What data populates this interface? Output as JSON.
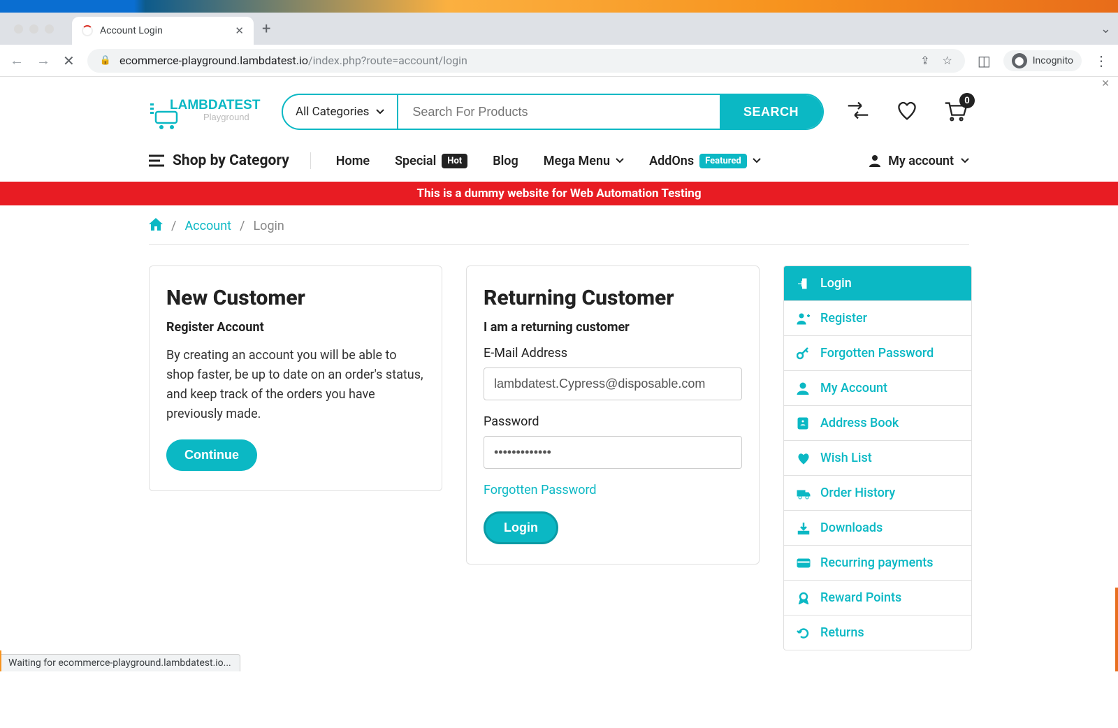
{
  "browser": {
    "tab_title": "Account Login",
    "url_host": "ecommerce-playground.lambdatest.io",
    "url_path": "/index.php?route=account/login",
    "incognito_label": "Incognito",
    "status": "Waiting for ecommerce-playground.lambdatest.io..."
  },
  "logo": {
    "top": "LAMBDATEST",
    "sub": "Playground"
  },
  "search": {
    "category": "All Categories",
    "placeholder": "Search For Products",
    "button": "SEARCH"
  },
  "header_icons": {
    "cart_count": "0"
  },
  "nav": {
    "shop_by": "Shop by Category",
    "items": [
      {
        "label": "Home"
      },
      {
        "label": "Special",
        "pill": "Hot",
        "pill_class": "hot"
      },
      {
        "label": "Blog"
      },
      {
        "label": "Mega Menu",
        "caret": true
      },
      {
        "label": "AddOns",
        "pill": "Featured",
        "pill_class": "feat",
        "caret": true
      }
    ],
    "my_account": "My account"
  },
  "banner": "This is a dummy website for Web Automation Testing",
  "breadcrumb": {
    "account": "Account",
    "login": "Login"
  },
  "new_customer": {
    "title": "New Customer",
    "subtitle": "Register Account",
    "body": "By creating an account you will be able to shop faster, be up to date on an order's status, and keep track of the orders you have previously made.",
    "button": "Continue"
  },
  "returning": {
    "title": "Returning Customer",
    "subtitle": "I am a returning customer",
    "email_label": "E-Mail Address",
    "email_value": "lambdatest.Cypress@disposable.com",
    "password_label": "Password",
    "password_value": "•••••••••••••",
    "forgot": "Forgotten Password",
    "button": "Login"
  },
  "sidemenu": [
    {
      "label": "Login",
      "icon": "login",
      "active": true
    },
    {
      "label": "Register",
      "icon": "register"
    },
    {
      "label": "Forgotten Password",
      "icon": "key"
    },
    {
      "label": "My Account",
      "icon": "user"
    },
    {
      "label": "Address Book",
      "icon": "address"
    },
    {
      "label": "Wish List",
      "icon": "heart"
    },
    {
      "label": "Order History",
      "icon": "truck"
    },
    {
      "label": "Downloads",
      "icon": "download"
    },
    {
      "label": "Recurring payments",
      "icon": "card"
    },
    {
      "label": "Reward Points",
      "icon": "reward"
    },
    {
      "label": "Returns",
      "icon": "return"
    }
  ]
}
